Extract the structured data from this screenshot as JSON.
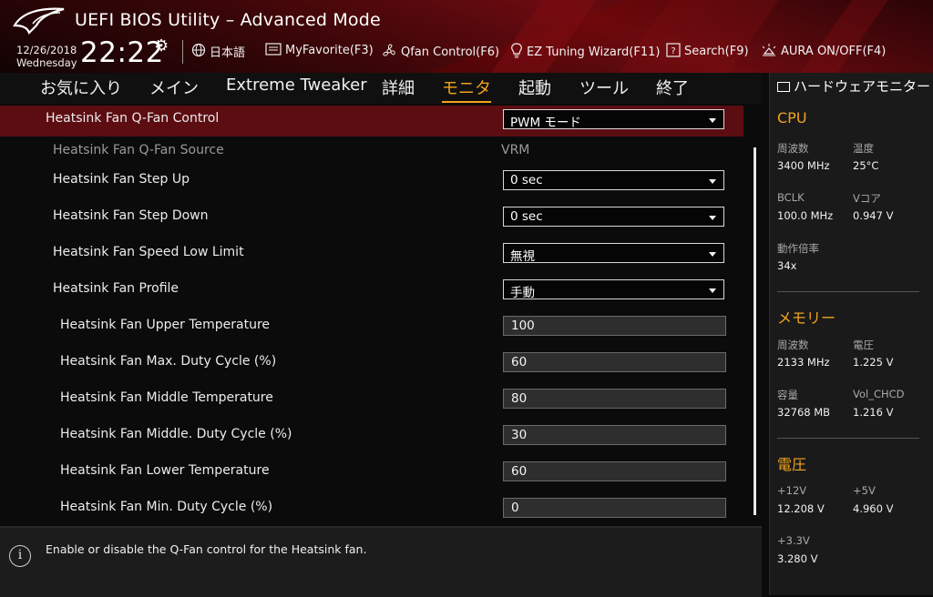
{
  "header": {
    "title": "UEFI BIOS Utility – Advanced Mode",
    "date": "12/26/2018",
    "weekday": "Wednesday",
    "time": "22:22",
    "tools": [
      {
        "label": "日本語",
        "icon": "globe-icon"
      },
      {
        "label": "MyFavorite(F3)",
        "icon": "favorite-list-icon"
      },
      {
        "label": "Qfan Control(F6)",
        "icon": "fan-icon"
      },
      {
        "label": "EZ Tuning Wizard(F11)",
        "icon": "lightbulb-icon"
      },
      {
        "label": "Search(F9)",
        "icon": "search-help-icon"
      },
      {
        "label": "AURA ON/OFF(F4)",
        "icon": "aura-light-icon"
      }
    ]
  },
  "tabs": [
    "お気に入り",
    "メイン",
    "Extreme Tweaker",
    "詳細",
    "モニタ",
    "起動",
    "ツール",
    "終了"
  ],
  "active_tab": "モニタ",
  "settings": {
    "qfan_control": {
      "label": "Heatsink Fan Q-Fan Control",
      "value": "PWM モード"
    },
    "qfan_source": {
      "label": "Heatsink Fan Q-Fan Source",
      "value": "VRM"
    },
    "step_up": {
      "label": "Heatsink Fan Step Up",
      "value": "0 sec"
    },
    "step_down": {
      "label": "Heatsink Fan Step Down",
      "value": "0 sec"
    },
    "speed_low_limit": {
      "label": "Heatsink Fan Speed Low Limit",
      "value": "無視"
    },
    "profile": {
      "label": "Heatsink Fan Profile",
      "value": "手動"
    },
    "upper_temp": {
      "label": "Heatsink Fan Upper Temperature",
      "value": "100"
    },
    "max_duty": {
      "label": "Heatsink Fan Max. Duty Cycle (%)",
      "value": "60"
    },
    "middle_temp": {
      "label": "Heatsink Fan Middle Temperature",
      "value": "80"
    },
    "middle_duty": {
      "label": "Heatsink Fan Middle. Duty Cycle (%)",
      "value": "30"
    },
    "lower_temp": {
      "label": "Heatsink Fan Lower Temperature",
      "value": "60"
    },
    "min_duty": {
      "label": "Heatsink Fan Min. Duty Cycle (%)",
      "value": "0"
    }
  },
  "help_text": "Enable or disable the Q-Fan control for the Heatsink fan.",
  "hw_monitor": {
    "title": "ハードウェアモニター",
    "cpu": {
      "title": "CPU",
      "freq_label": "周波数",
      "freq": "3400 MHz",
      "temp_label": "温度",
      "temp": "25°C",
      "bclk_label": "BCLK",
      "bclk": "100.0 MHz",
      "vcore_label": "Vコア",
      "vcore": "0.947 V",
      "ratio_label": "動作倍率",
      "ratio": "34x"
    },
    "memory": {
      "title": "メモリー",
      "freq_label": "周波数",
      "freq": "2133 MHz",
      "volt_label": "電圧",
      "volt": "1.225 V",
      "cap_label": "容量",
      "cap": "32768 MB",
      "chcd_label": "Vol_CHCD",
      "chcd": "1.216 V"
    },
    "voltage": {
      "title": "電圧",
      "v12_label": "+12V",
      "v12": "12.208 V",
      "v5_label": "+5V",
      "v5": "4.960 V",
      "v33_label": "+3.3V",
      "v33": "3.280 V"
    }
  },
  "colors": {
    "accent": "#f0a41e",
    "selected_row": "#5c0d12",
    "header_red": "#6a0b10"
  }
}
